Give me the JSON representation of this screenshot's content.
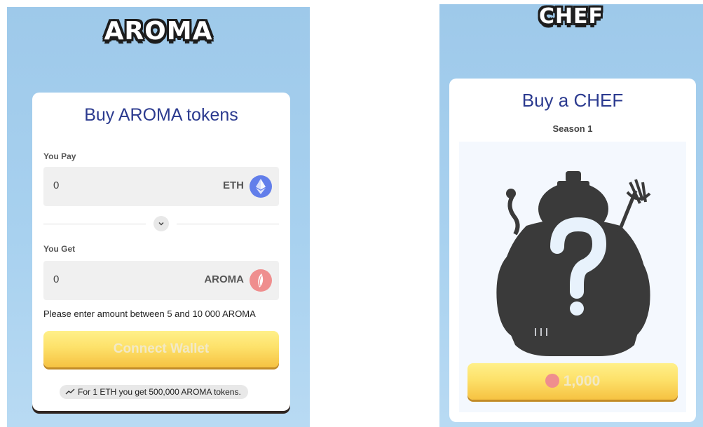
{
  "aroma_panel": {
    "logo": "AROMA",
    "title": "Buy AROMA tokens",
    "pay": {
      "label": "You Pay",
      "value": "0",
      "currency": "ETH",
      "icon": "ethereum-icon"
    },
    "get": {
      "label": "You Get",
      "value": "0",
      "currency": "AROMA",
      "icon": "aroma-token-icon"
    },
    "swap_icon": "chevron-down-icon",
    "hint": "Please enter amount between 5 and 10 000 AROMA",
    "connect_label": "Connect Wallet",
    "rate_icon": "trend-icon",
    "rate_text": "For 1 ETH you get 500,000 AROMA tokens."
  },
  "chef_panel": {
    "logo": "CHEF",
    "title": "Buy a CHEF",
    "season": "Season 1",
    "image": "mystery-chef-silhouette",
    "price": "1,000",
    "price_icon": "aroma-token-icon"
  },
  "colors": {
    "background": "#a8d1ef",
    "title": "#2b3a8f",
    "button_yellow": "#fde16a",
    "eth": "#627eea",
    "aroma": "#ef8e8e"
  }
}
